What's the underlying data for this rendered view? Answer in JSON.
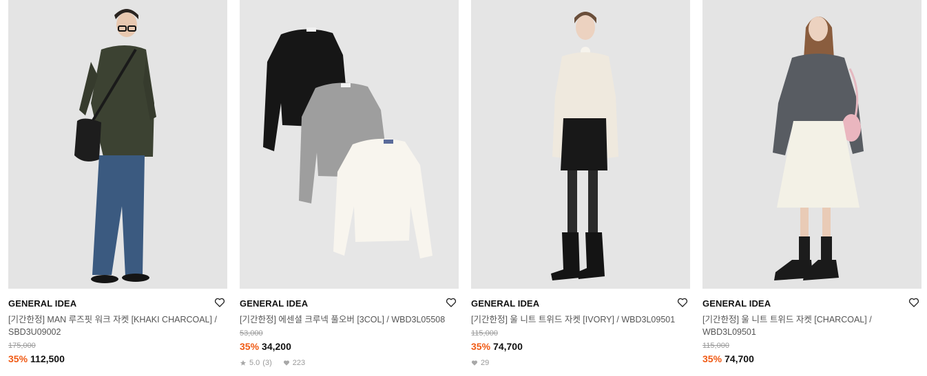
{
  "products": [
    {
      "brand": "GENERAL IDEA",
      "name": "[기간한정] MAN 루즈핏 워크 자켓 [KHAKI CHARCOAL] / SBD3U09002",
      "original_price": "175,000",
      "discount": "35%",
      "price": "112,500",
      "rating": "",
      "reviews": "",
      "likes": ""
    },
    {
      "brand": "GENERAL IDEA",
      "name": "[기간한정] 에센셜 크루넥 풀오버 [3COL] / WBD3L05508",
      "original_price": "53,000",
      "discount": "35%",
      "price": "34,200",
      "rating": "5.0",
      "reviews": "(3)",
      "likes": "223"
    },
    {
      "brand": "GENERAL IDEA",
      "name": "[기간한정] 울 니트 트위드 자켓 [IVORY] / WBD3L09501",
      "original_price": "115,000",
      "discount": "35%",
      "price": "74,700",
      "rating": "",
      "reviews": "",
      "likes": "29"
    },
    {
      "brand": "GENERAL IDEA",
      "name": "[기간한정] 울 니트 트위드 자켓 [CHARCOAL] / WBD3L09501",
      "original_price": "115,000",
      "discount": "35%",
      "price": "74,700",
      "rating": "",
      "reviews": "",
      "likes": ""
    }
  ],
  "icons": {
    "wish": "heart-outline-icon",
    "rating": "star-icon",
    "likes": "heart-icon"
  },
  "colors": {
    "discount": "#f05a14",
    "image_bg": "#e6e6e6",
    "meta": "#999999"
  }
}
